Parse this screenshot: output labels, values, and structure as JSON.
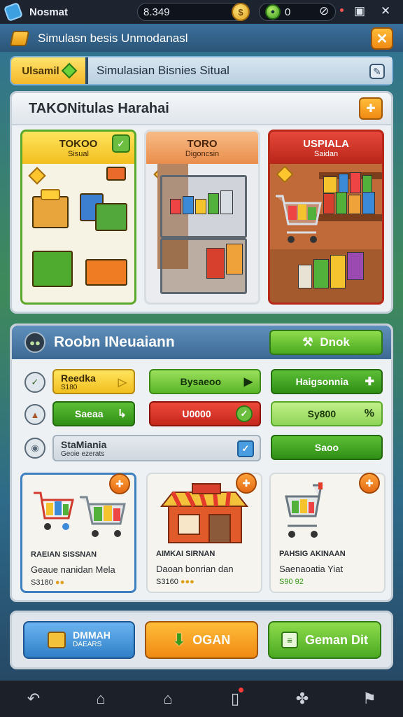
{
  "status_bar": {
    "app_name": "Nosmat",
    "coins": "8.349",
    "coin_glyph": "$",
    "gems": "0",
    "icons": [
      "app-icon",
      "coin-icon",
      "gem-icon",
      "compass-icon",
      "minimize-icon",
      "close-icon"
    ]
  },
  "title_bar": {
    "title": "Simulasn besis Unmodanasl",
    "close_label": "✕"
  },
  "search": {
    "tag_label": "Ulsamil",
    "value": "Simulasian Bisnies Situal"
  },
  "store_panel": {
    "title": "TAKONitulas Harahai",
    "stores": [
      {
        "title": "TOKOO",
        "subtitle": "Sisual"
      },
      {
        "title": "TORO",
        "subtitle": "Digoncsin"
      },
      {
        "title": "USPIALA",
        "subtitle": "Saidan"
      }
    ]
  },
  "options_panel": {
    "title": "Roobn INeuaiann",
    "head_button": "Dnok",
    "rows": [
      [
        {
          "label": "Reedka",
          "sub": "S180",
          "arrow": "▷"
        },
        {
          "label": "Bysaeoo",
          "arrow": "▶"
        },
        {
          "label": "Haigsonnia",
          "arrow": "✚"
        }
      ],
      [
        {
          "label": "Saeaa",
          "arrow": "↳"
        },
        {
          "label": "U0000"
        },
        {
          "label": "Sy800",
          "arrow": "%"
        }
      ],
      [
        {
          "label": "StaMiania",
          "sub": "Geoie ezerats"
        },
        {
          "label": "Saoo"
        }
      ]
    ],
    "products": [
      {
        "title": "RAEIAN SISSNAN",
        "desc": "Geaue nanidan Mela",
        "price": "S3180"
      },
      {
        "title": "AIMKAI SIRNAN",
        "desc": "Daoan bonrian dan",
        "price": "S3160"
      },
      {
        "title": "PAHSIG AKINAAN",
        "desc": "Saenaoatia Yiat",
        "price": "S90 92"
      }
    ]
  },
  "bottom_actions": {
    "blue_label": "DMMAH",
    "blue_sub": "DAEARS",
    "orange_label": "OGAN",
    "green_label": "Geman Dit"
  },
  "nav_bar": {
    "icons": [
      "back-icon",
      "home-outline-icon",
      "home-icon",
      "notification-icon",
      "game-icon",
      "flag-icon"
    ]
  },
  "colors": {
    "accent_orange": "#f08a12",
    "accent_green": "#4aa921",
    "accent_red": "#c4261a",
    "accent_blue": "#2f7fc8",
    "title_blue": "#3c6994"
  }
}
